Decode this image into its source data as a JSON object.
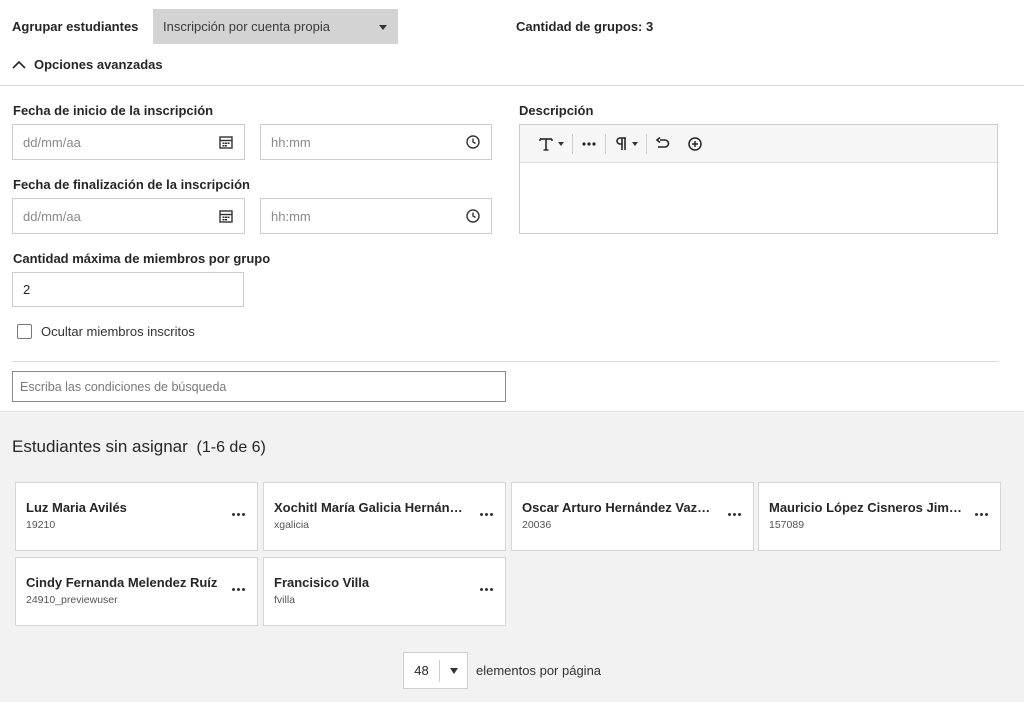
{
  "header": {
    "group_label": "Agrupar estudiantes",
    "group_select_value": "Inscripción por cuenta propia",
    "group_count": "Cantidad de grupos: 3",
    "advanced_toggle": "Opciones avanzadas"
  },
  "form": {
    "start_label": "Fecha de inicio de la inscripción",
    "end_label": "Fecha de finalización de la inscripción",
    "date_placeholder": "dd/mm/aa",
    "time_placeholder": "hh:mm",
    "max_label": "Cantidad máxima de miembros por grupo",
    "max_value": "2",
    "hide_members_label": "Ocultar miembros inscritos",
    "description_label": "Descripción"
  },
  "search": {
    "placeholder": "Escriba las condiciones de búsqueda"
  },
  "unassigned": {
    "title": "Estudiantes sin asignar",
    "count": "(1-6 de 6)",
    "students": [
      {
        "name": "Luz Maria Avilés",
        "id": "19210"
      },
      {
        "name": "Xochitl María Galicia Hernández",
        "id": "xgalicia"
      },
      {
        "name": "Oscar Arturo Hernández Vazquez",
        "id": "20036"
      },
      {
        "name": "Mauricio López Cisneros Jiménez",
        "id": "157089"
      },
      {
        "name": "Cindy Fernanda Melendez Ruíz",
        "id": "24910_previewuser"
      },
      {
        "name": "Francisico Villa",
        "id": "fvilla"
      }
    ]
  },
  "pagination": {
    "page_size": "48",
    "per_page_label": "elementos por página"
  },
  "icons": {
    "calendar": "calendar-icon",
    "clock": "clock-icon",
    "chevron": "chevron-up-icon",
    "more": "more-options-icon"
  }
}
